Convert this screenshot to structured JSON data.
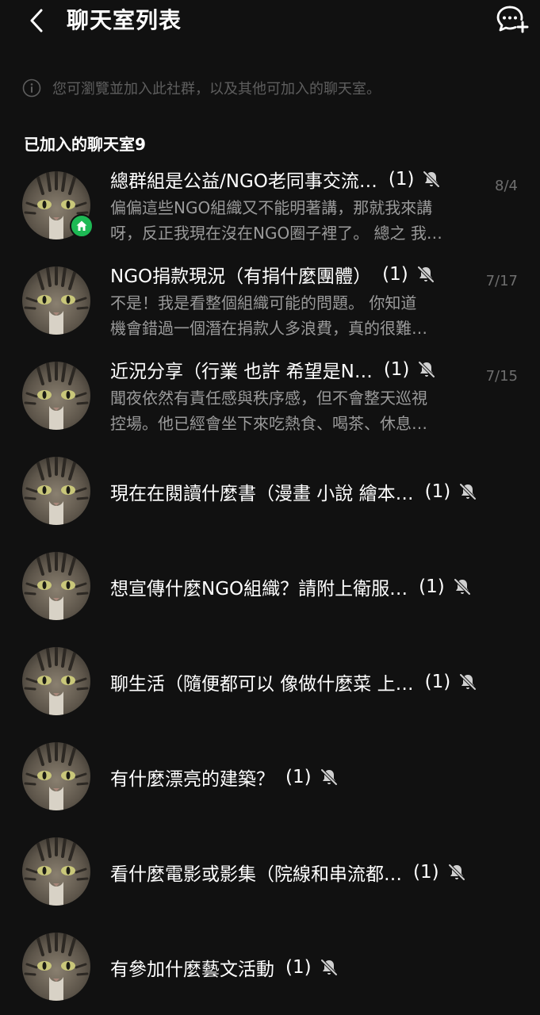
{
  "header": {
    "title": "聊天室列表",
    "back_icon": "chevron-left-icon",
    "new_chat_icon": "chat-bubble-plus-icon"
  },
  "notice": {
    "icon": "info-icon",
    "text": "您可瀏覽並加入此社群，以及其他可加入的聊天室。"
  },
  "section": {
    "title": "已加入的聊天室9"
  },
  "rooms": [
    {
      "title": "總群組是公益/NGO老同事交流…",
      "count": "(1)",
      "muted": true,
      "date": "8/4",
      "badge": "home-icon",
      "preview": [
        "偏偏這些NGO組織又不能明著講，那就我來講",
        "呀，反正我現在沒在NGO圈子裡了。 總之 我…"
      ]
    },
    {
      "title": "NGO捐款現況（有捐什麼團體）",
      "count": "(1)",
      "muted": true,
      "date": "7/17",
      "preview": [
        "不是！我是看整個組織可能的問題。 你知道",
        "機會錯過一個潛在捐款人多浪費，真的很難…"
      ]
    },
    {
      "title": "近況分享（行業 也許 希望是N…",
      "count": "(1)",
      "muted": true,
      "date": "7/15",
      "preview": [
        "聞夜依然有責任感與秩序感，但不會整天巡視",
        "控場。他已經會坐下來吃熱食、喝茶、休息…"
      ]
    },
    {
      "title": "現在在閱讀什麼書（漫畫 小說 繪本…",
      "count": "(1)",
      "muted": true
    },
    {
      "title": "想宣傳什麼NGO組織？請附上衛服…",
      "count": "(1)",
      "muted": true
    },
    {
      "title": "聊生活（隨便都可以 像做什麼菜 上…",
      "count": "(1)",
      "muted": true
    },
    {
      "title": "有什麼漂亮的建築？",
      "count": "(1)",
      "muted": true
    },
    {
      "title": "看什麼電影或影集（院線和串流都…",
      "count": "(1)",
      "muted": true
    },
    {
      "title": "有參加什麼藝文活動",
      "count": "(1)",
      "muted": true
    }
  ],
  "colors": {
    "background": "#111111",
    "text_primary": "#ffffff",
    "text_secondary": "#9a9a9a",
    "date": "#6e6e6e",
    "badge_green": "#1db954"
  }
}
